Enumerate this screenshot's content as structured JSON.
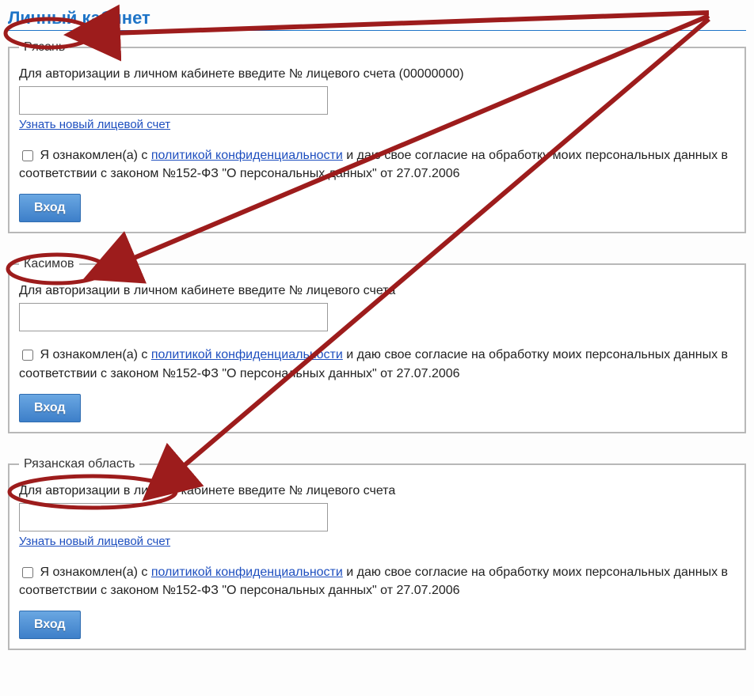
{
  "page_title": "Личный кабинет",
  "sections": [
    {
      "legend": "Рязань",
      "instruction": "Для авторизации в личном кабинете введите № лицевого счета (00000000)",
      "has_new_account_link": true,
      "new_account_link_label": "Узнать новый лицевой счет",
      "consent_prefix": "Я ознакомлен(а) с ",
      "policy_link_label": "политикой конфиденциальности",
      "consent_suffix": " и даю свое согласие на обработку моих персональных данных в соответствии с законом №152-ФЗ \"О персональных данных\" от 27.07.2006",
      "login_label": "Вход"
    },
    {
      "legend": "Касимов",
      "instruction": "Для авторизации в личном кабинете введите № лицевого счета",
      "has_new_account_link": false,
      "consent_prefix": "Я ознакомлен(а) с ",
      "policy_link_label": "политикой конфиденциальности",
      "consent_suffix": " и даю свое согласие на обработку моих персональных данных в соответствии с законом №152-ФЗ \"О персональных данных\" от 27.07.2006",
      "login_label": "Вход"
    },
    {
      "legend": "Рязанская область",
      "instruction": "Для авторизации в личном кабинете введите № лицевого счета",
      "has_new_account_link": true,
      "new_account_link_label": "Узнать новый лицевой счет",
      "consent_prefix": "Я ознакомлен(а) с ",
      "policy_link_label": "политикой конфиденциальности",
      "consent_suffix": " и даю свое согласие на обработку моих персональных данных в соответствии с законом №152-ФЗ \"О персональных данных\" от 27.07.2006",
      "login_label": "Вход"
    }
  ],
  "annotation_color": "#9d1c1c"
}
